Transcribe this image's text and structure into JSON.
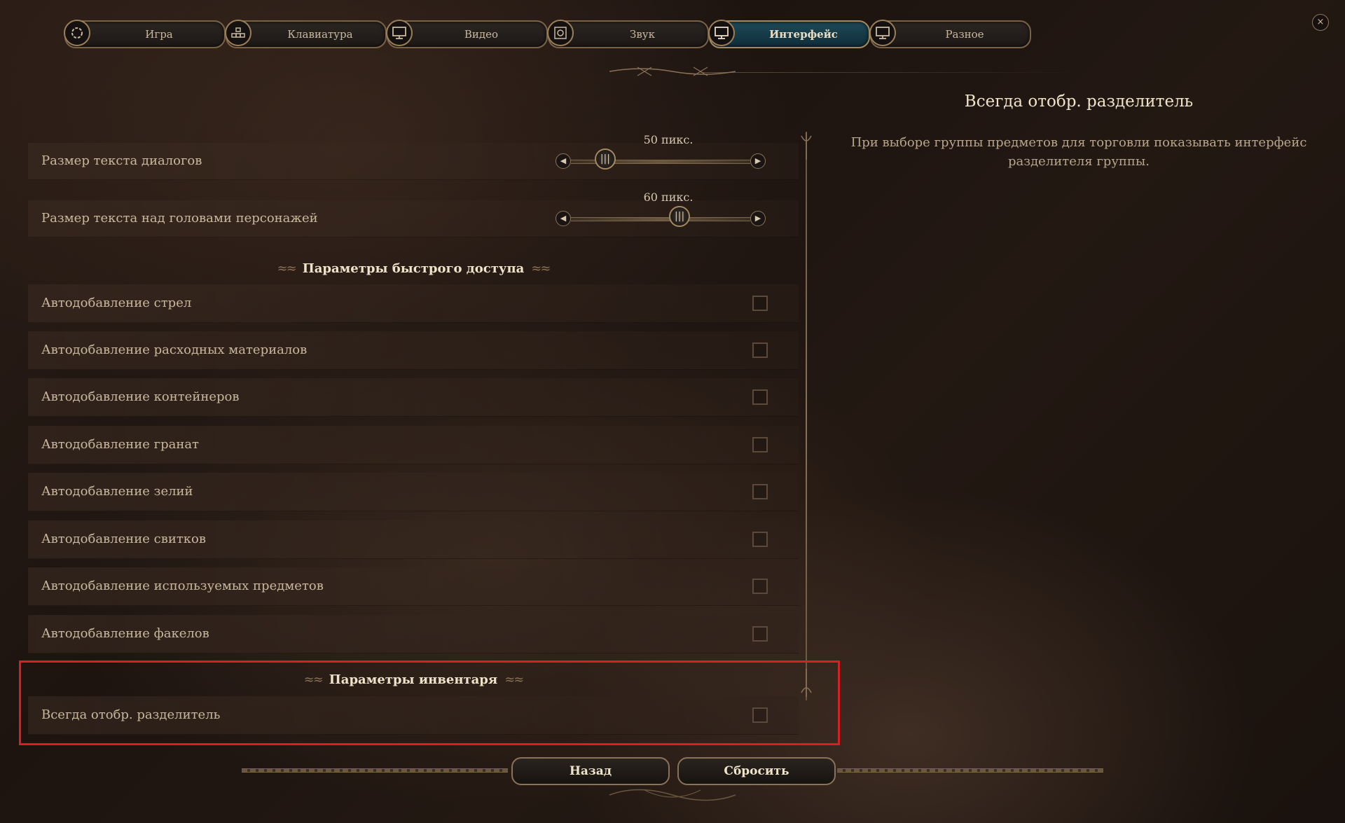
{
  "tabs": [
    {
      "label": "Игра",
      "icon": "gear-icon",
      "active": false
    },
    {
      "label": "Клавиатура",
      "icon": "keyboard-icon",
      "active": false
    },
    {
      "label": "Видео",
      "icon": "monitor-icon",
      "active": false
    },
    {
      "label": "Звук",
      "icon": "speaker-icon",
      "active": false
    },
    {
      "label": "Интерфейс",
      "icon": "monitor-icon",
      "active": true
    },
    {
      "label": "Разное",
      "icon": "monitor-icon",
      "active": false
    }
  ],
  "close": {
    "glyph": "×"
  },
  "sliders": [
    {
      "label": "Размер текста диалогов",
      "value_text": "50 пикс.",
      "fraction": 0.15
    },
    {
      "label": "Размер текста над головами персонажей",
      "value_text": "60 пикс.",
      "fraction": 0.62
    }
  ],
  "quick_access": {
    "title": "Параметры быстрого доступа",
    "items": [
      "Автодобавление стрел",
      "Автодобавление расходных материалов",
      "Автодобавление контейнеров",
      "Автодобавление гранат",
      "Автодобавление зелий",
      "Автодобавление свитков",
      "Автодобавление используемых предметов",
      "Автодобавление факелов"
    ]
  },
  "inventory": {
    "title": "Параметры инвентаря",
    "items": [
      "Всегда отобр. разделитель"
    ]
  },
  "description": {
    "title": "Всегда отобр. разделитель",
    "text": "При выборе группы предметов для торговли показывать интерфейс разделителя группы."
  },
  "buttons": {
    "back": "Назад",
    "reset": "Сбросить"
  },
  "colors": {
    "highlight": "#d81f26",
    "active_tab": "#1e4a58",
    "gold_border": "#8a7258"
  }
}
